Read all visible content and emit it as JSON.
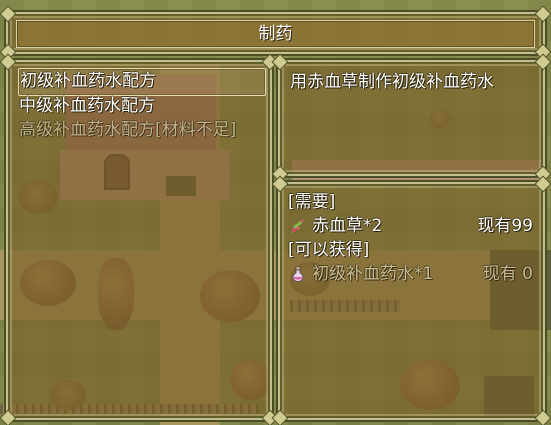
{
  "title": "制药",
  "recipes": [
    {
      "label": "初级补血药水配方",
      "state": "selected"
    },
    {
      "label": "中级补血药水配方",
      "state": "enabled"
    },
    {
      "label": "高级补血药水配方[材料不足]",
      "state": "disabled"
    }
  ],
  "description": "用赤血草制作初级补血药水",
  "requirement": {
    "needed_header": "[需要]",
    "needed_item": {
      "name": "赤血草*2",
      "count_text": "现有99",
      "icon": "herb-icon"
    },
    "obtain_header": "[可以获得]",
    "obtain_item": {
      "name": "初级补血药水*1",
      "count_text": "现有 0",
      "icon": "potion-icon"
    }
  }
}
